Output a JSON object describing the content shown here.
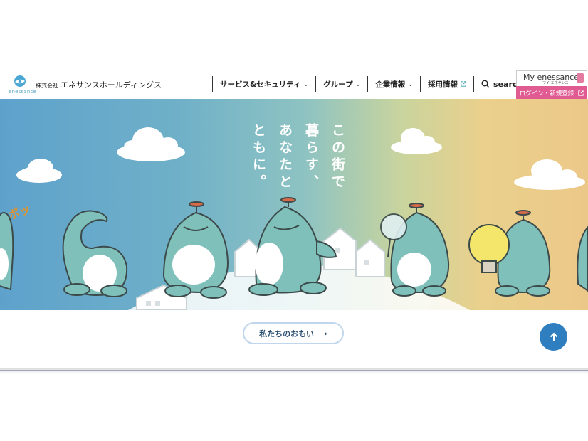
{
  "header": {
    "logo_word": "enessance",
    "company_prefix": "株式会社",
    "company_name": "エネサンスホールディングス",
    "nav": [
      {
        "label": "サービス&セキュリティ"
      },
      {
        "label": "グループ"
      },
      {
        "label": "企業情報"
      },
      {
        "label": "採用情報"
      }
    ],
    "search_label": "search",
    "my_title": "My enessance",
    "my_sub": "マイ エネサンス",
    "login_label": "ログイン・新規登録"
  },
  "hero": {
    "tagline_lines": [
      "この街で",
      "暮らす、",
      "あなたと",
      "ともに。"
    ],
    "sfx": "ポッ"
  },
  "lower": {
    "omoi_label": "私たちのおもい",
    "omoi_arrow": "›"
  },
  "colors": {
    "accent_pink": "#e05b92",
    "accent_blue": "#2f7fc0",
    "character_teal": "#7fc0bb"
  }
}
